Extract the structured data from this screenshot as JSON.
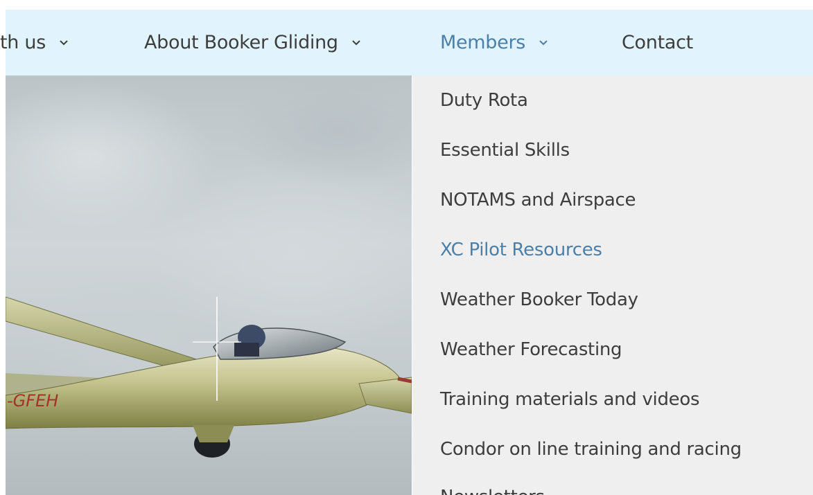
{
  "nav": {
    "items": [
      {
        "label": "th us",
        "has_dropdown": true,
        "active": false
      },
      {
        "label": "About Booker Gliding",
        "has_dropdown": true,
        "active": false
      },
      {
        "label": "Members",
        "has_dropdown": true,
        "active": true
      },
      {
        "label": "Contact",
        "has_dropdown": false,
        "active": false
      }
    ]
  },
  "hero": {
    "registration": "-GFEH"
  },
  "dropdown": {
    "items": [
      {
        "label": "Duty Rota",
        "active": false
      },
      {
        "label": "Essential Skills",
        "active": false
      },
      {
        "label": "NOTAMS and Airspace",
        "active": false
      },
      {
        "label": "XC Pilot Resources",
        "active": true
      },
      {
        "label": "Weather Booker Today",
        "active": false
      },
      {
        "label": "Weather Forecasting",
        "active": false
      },
      {
        "label": "Training materials and videos",
        "active": false
      },
      {
        "label": "Condor on line training and racing",
        "active": false
      },
      {
        "label": "Newsletters",
        "active": false
      }
    ]
  },
  "colors": {
    "nav_bg": "#e1f4fd",
    "dropdown_bg": "#efefef",
    "text": "#3d3d3d",
    "accent": "#4a7fa9"
  }
}
